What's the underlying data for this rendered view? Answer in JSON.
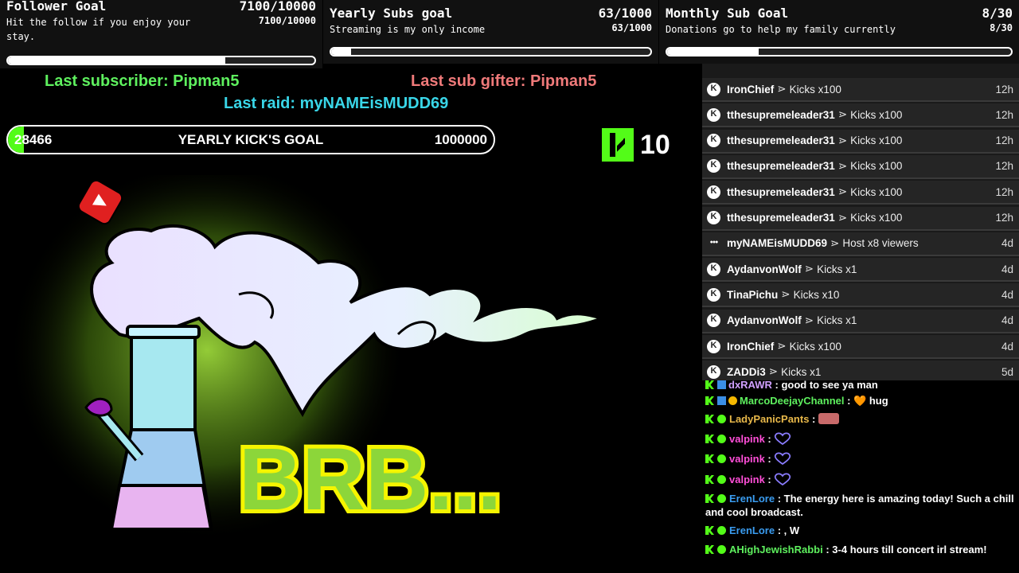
{
  "goals": [
    {
      "title": "Follower Goal",
      "count": "7100/10000",
      "desc": "Hit the follow if you enjoy your stay.",
      "count2": "7100/10000",
      "progress": 0.71
    },
    {
      "title": "Yearly Subs goal",
      "count": "63/1000",
      "desc": "Streaming is my only income",
      "count2": "63/1000",
      "progress": 0.063
    },
    {
      "title": "Monthly Sub Goal",
      "count": "8/30",
      "desc": "Donations go to help my family currently",
      "count2": "8/30",
      "progress": 0.267
    }
  ],
  "last": {
    "subscriber": "Last subscriber: Pipman5",
    "gifter": "Last sub gifter: Pipman5",
    "raid": "Last raid: myNAMEisMUDD69"
  },
  "kicks_goal": {
    "current": "28466",
    "label": "YEARLY KICK'S GOAL",
    "target": "1000000",
    "progress": 0.028466
  },
  "kick_counter": "10",
  "brb_text": "BRB...",
  "feed": [
    {
      "name": "IronChief",
      "sep": "⋗",
      "action": "Kicks x100",
      "time": "12h",
      "icon": "kick"
    },
    {
      "name": "tthesupremeleader31",
      "sep": "⋗",
      "action": "Kicks x100",
      "time": "12h",
      "icon": "kick"
    },
    {
      "name": "tthesupremeleader31",
      "sep": "⋗",
      "action": "Kicks x100",
      "time": "12h",
      "icon": "kick"
    },
    {
      "name": "tthesupremeleader31",
      "sep": "⋗",
      "action": "Kicks x100",
      "time": "12h",
      "icon": "kick"
    },
    {
      "name": "tthesupremeleader31",
      "sep": "⋗",
      "action": "Kicks x100",
      "time": "12h",
      "icon": "kick"
    },
    {
      "name": "tthesupremeleader31",
      "sep": "⋗",
      "action": "Kicks x100",
      "time": "12h",
      "icon": "kick"
    },
    {
      "name": "myNAMEisMUDD69",
      "sep": "⋗",
      "action": "Host x8 viewers",
      "time": "4d",
      "icon": "host"
    },
    {
      "name": "AydanvonWolf",
      "sep": "⋗",
      "action": "Kicks x1",
      "time": "4d",
      "icon": "kick"
    },
    {
      "name": "TinaPichu",
      "sep": "⋗",
      "action": "Kicks x10",
      "time": "4d",
      "icon": "kick"
    },
    {
      "name": "AydanvonWolf",
      "sep": "⋗",
      "action": "Kicks x1",
      "time": "4d",
      "icon": "kick"
    },
    {
      "name": "IronChief",
      "sep": "⋗",
      "action": "Kicks x100",
      "time": "4d",
      "icon": "kick"
    },
    {
      "name": "ZADDi3",
      "sep": "⋗",
      "action": "Kicks x1",
      "time": "5d",
      "icon": "kick"
    }
  ],
  "chat": [
    {
      "user": "dxRAWR",
      "color": "#d0a0ff",
      "msg": " : good to see ya man"
    },
    {
      "user": "MarcoDeejayChannel",
      "color": "#5ef05e",
      "msg": " : 🧡 hug"
    },
    {
      "user": "LadyPanicPants",
      "color": "#e8b84a",
      "msg": " : "
    },
    {
      "user": "valpink",
      "color": "#ff4fd8",
      "msg": " : "
    },
    {
      "user": "valpink",
      "color": "#ff4fd8",
      "msg": " : "
    },
    {
      "user": "valpink",
      "color": "#ff4fd8",
      "msg": " : "
    },
    {
      "user": "ErenLore",
      "color": "#3a9cf0",
      "msg": " : The energy here is amazing today! Such a chill and cool broadcast."
    },
    {
      "user": "ErenLore",
      "color": "#3a9cf0",
      "msg": " :  , W"
    },
    {
      "user": "AHighJewishRabbi",
      "color": "#5ef05e",
      "msg": " : 3-4 hours till concert irl stream!"
    }
  ],
  "colors": {
    "kick_green": "#53fc18",
    "sub_green": "#5ef05e",
    "gifter_red": "#f07a7a",
    "raid_cyan": "#39d6e8"
  }
}
